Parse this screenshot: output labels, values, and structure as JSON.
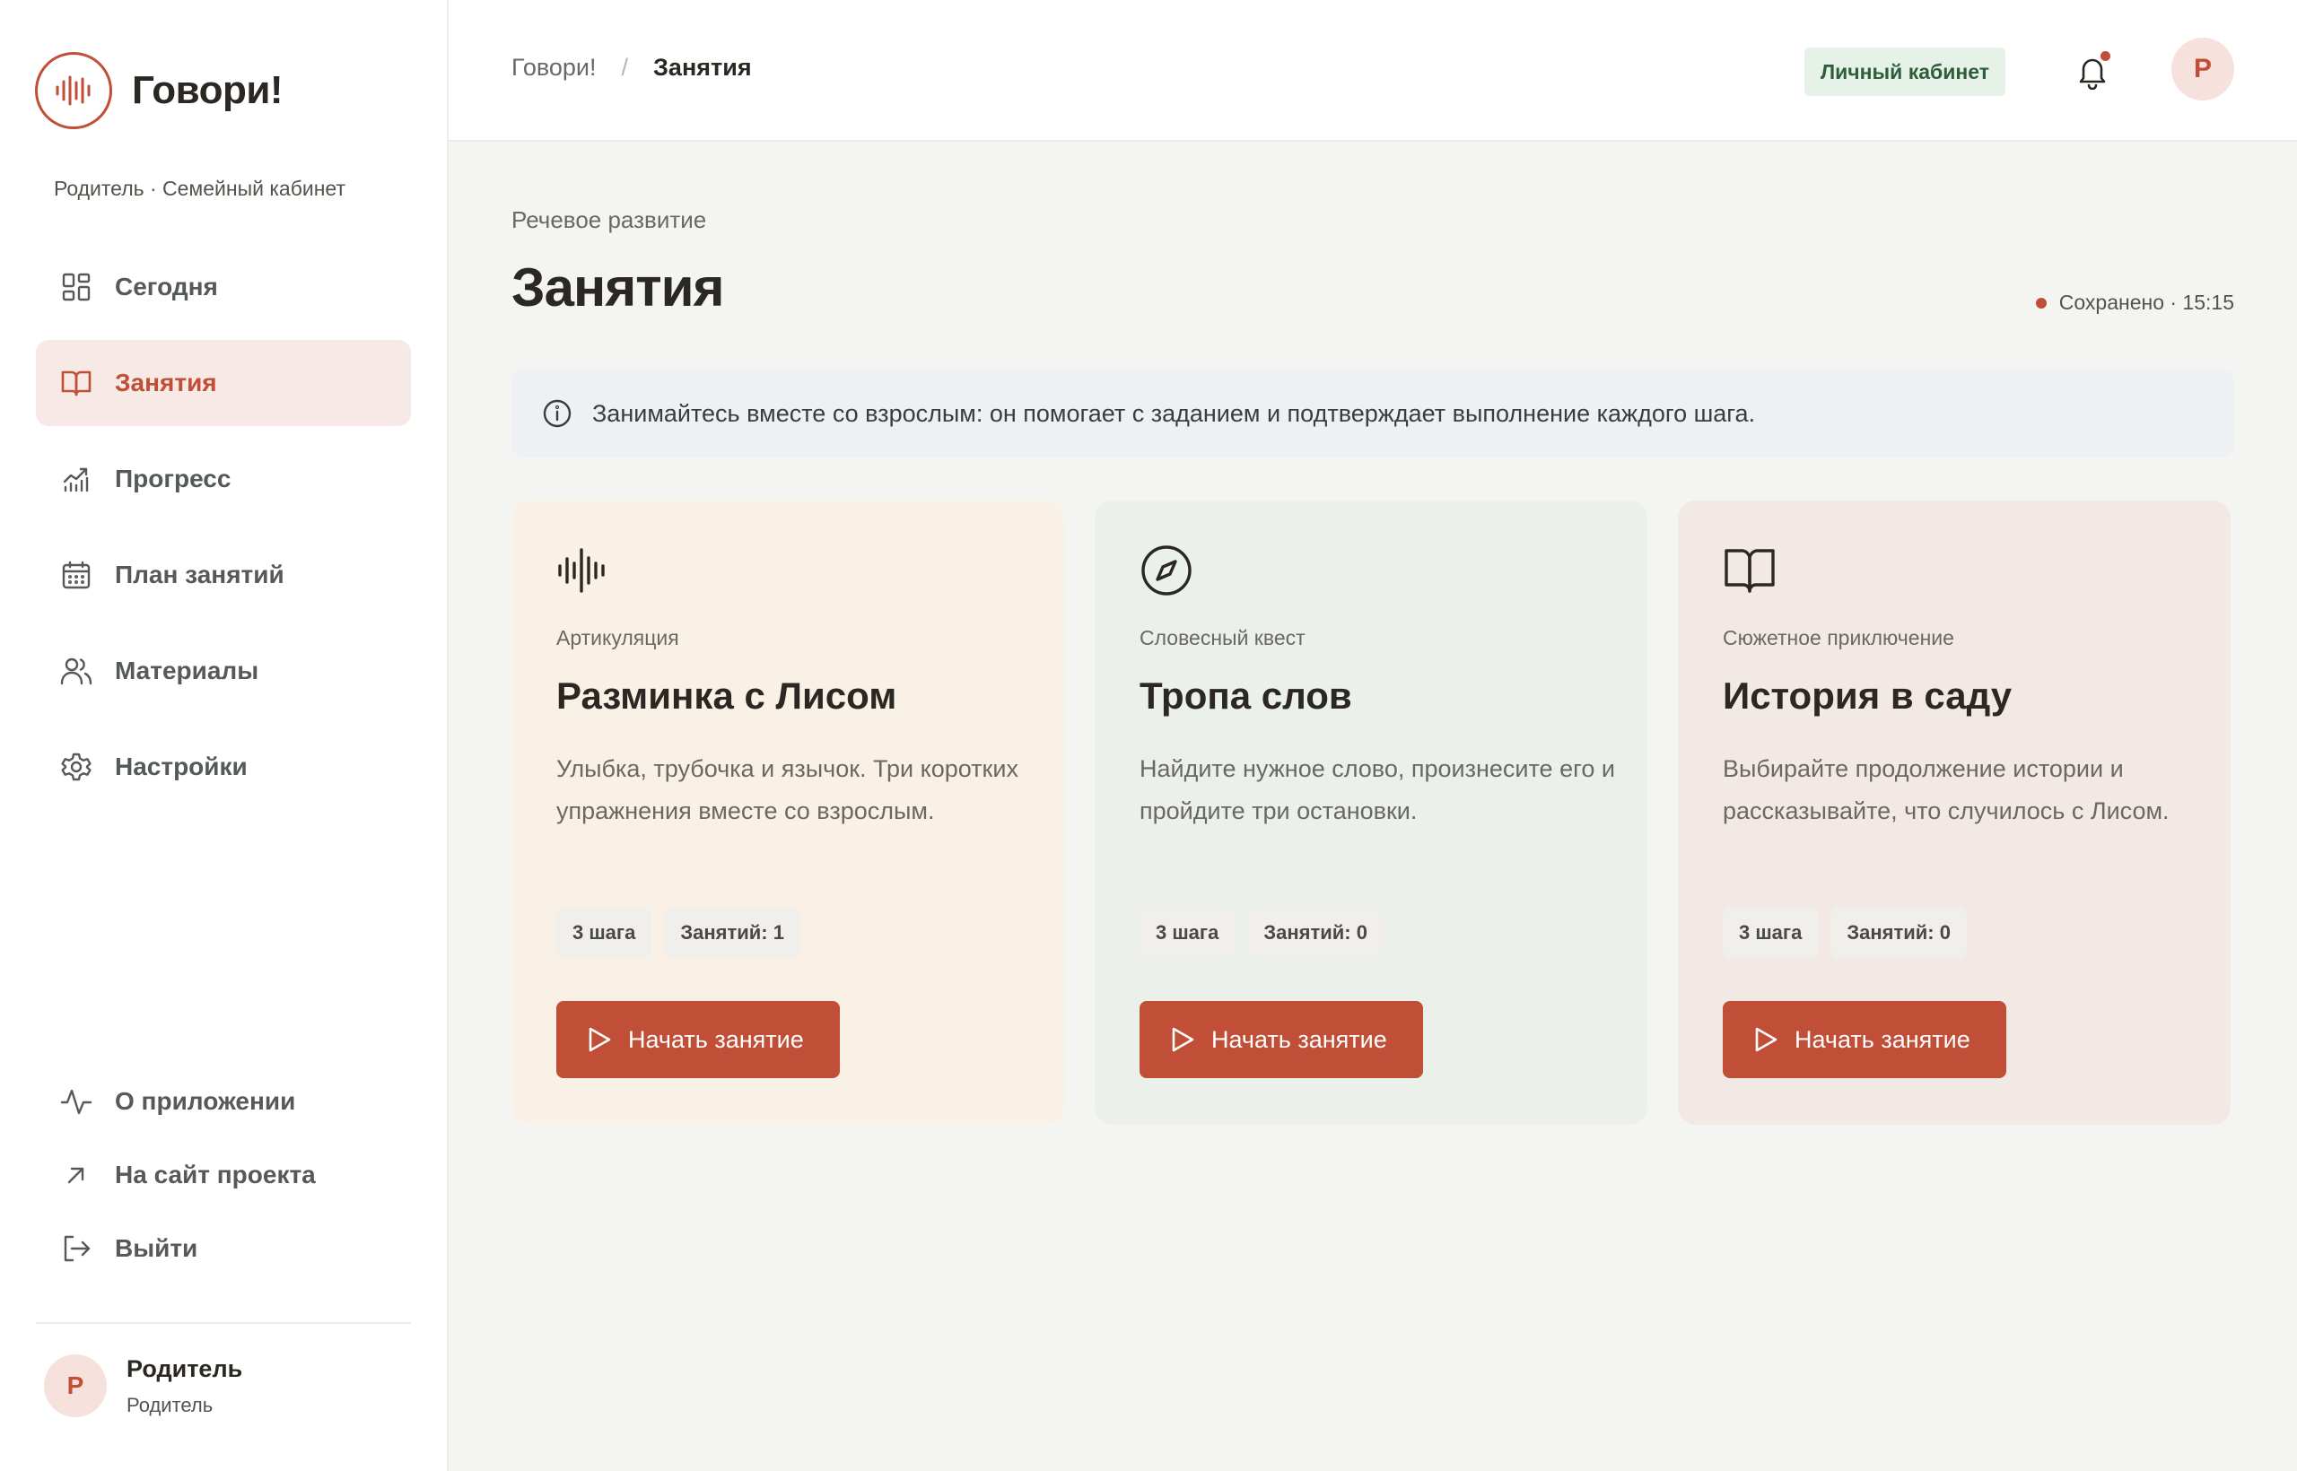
{
  "brand": {
    "name": "Говори!",
    "subtitle": "Родитель · Семейный кабинет"
  },
  "nav": {
    "items": [
      {
        "label": "Сегодня",
        "icon": "dashboard-icon",
        "active": false
      },
      {
        "label": "Занятия",
        "icon": "book-open-icon",
        "active": true
      },
      {
        "label": "Прогресс",
        "icon": "chart-icon",
        "active": false
      },
      {
        "label": "План занятий",
        "icon": "calendar-icon",
        "active": false
      },
      {
        "label": "Материалы",
        "icon": "users-icon",
        "active": false
      },
      {
        "label": "Настройки",
        "icon": "gear-icon",
        "active": false
      }
    ],
    "bottom": [
      {
        "label": "О приложении",
        "icon": "activity-icon"
      },
      {
        "label": "На сайт проекта",
        "icon": "arrow-up-right-icon"
      },
      {
        "label": "Выйти",
        "icon": "logout-icon"
      }
    ]
  },
  "user": {
    "initial": "Р",
    "name": "Родитель",
    "role": "Родитель"
  },
  "header": {
    "breadcrumb_root": "Говори!",
    "breadcrumb_sep": "/",
    "breadcrumb_current": "Занятия",
    "cabinet_button": "Личный кабинет",
    "avatar_initial": "Р"
  },
  "main": {
    "section_label": "Речевое развитие",
    "title": "Занятия",
    "saved_status": "Сохранено · 15:15",
    "info_text": "Занимайтесь вместе со взрослым: он помогает с заданием и подтверждает выполнение каждого шага."
  },
  "cards": [
    {
      "category": "Артикуляция",
      "title": "Разминка с Лисом",
      "description": "Улыбка, трубочка и язычок. Три коротких упражнения вместе со взрослым.",
      "tags": [
        "3 шага",
        "Занятий: 1"
      ],
      "button": "Начать занятие",
      "icon": "waveform-icon",
      "bg": "#faf1e6"
    },
    {
      "category": "Словесный квест",
      "title": "Тропа слов",
      "description": "Найдите нужное слово, произнесите его и пройдите три остановки.",
      "tags": [
        "3 шага",
        "Занятий: 0"
      ],
      "button": "Начать занятие",
      "icon": "compass-icon",
      "bg": "#ecf0ea"
    },
    {
      "category": "Сюжетное приключение",
      "title": "История в саду",
      "description": "Выбирайте продолжение истории и рассказывайте, что случилось с Лисом.",
      "tags": [
        "3 шага",
        "Занятий: 0"
      ],
      "button": "Начать занятие",
      "icon": "book-open-icon",
      "bg": "#f3e9e4"
    }
  ],
  "colors": {
    "accent": "#c14e36",
    "active_nav_bg": "#f7e9e5",
    "cabinet_bg": "#e6f1e8",
    "cabinet_text": "#2f5d3c",
    "info_bg": "#edf1f4"
  }
}
